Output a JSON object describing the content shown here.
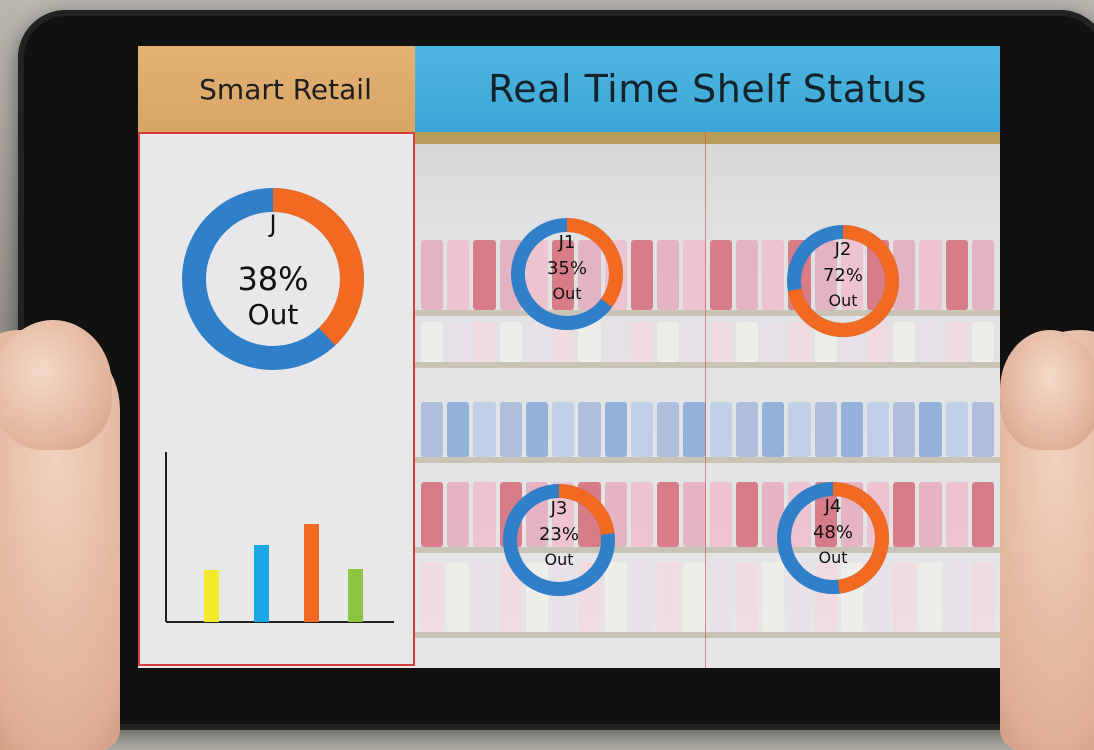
{
  "header": {
    "left_title": "Smart Retail",
    "right_title": "Real Time Shelf Status"
  },
  "main_donut": {
    "label": "J",
    "percent_text": "38%",
    "status_text": "Out",
    "out_fraction": 0.38,
    "colors": {
      "out": "#f26a21",
      "in": "#2f7fc9"
    }
  },
  "shelf_donuts": [
    {
      "label": "J1",
      "percent_text": "35%",
      "status_text": "Out",
      "out_fraction": 0.35
    },
    {
      "label": "J2",
      "percent_text": "72%",
      "status_text": "Out",
      "out_fraction": 0.72
    },
    {
      "label": "J3",
      "percent_text": "23%",
      "status_text": "Out",
      "out_fraction": 0.23
    },
    {
      "label": "J4",
      "percent_text": "48%",
      "status_text": "Out",
      "out_fraction": 0.48
    }
  ],
  "chart_data": {
    "type": "bar",
    "categories": [
      "",
      "",
      "",
      ""
    ],
    "values": [
      52,
      77,
      98,
      53
    ],
    "colors": [
      "#f5ea2a",
      "#1aa7e8",
      "#f26a21",
      "#8cc63f"
    ],
    "title": "",
    "xlabel": "",
    "ylabel": "",
    "ylim": [
      0,
      170
    ]
  },
  "colors": {
    "donut_out": "#f26a21",
    "donut_in": "#2f7fc9",
    "header_left_bg": "#e0ad6e",
    "header_right_bg": "#44b0dc",
    "panel_border": "#d83b3b"
  }
}
